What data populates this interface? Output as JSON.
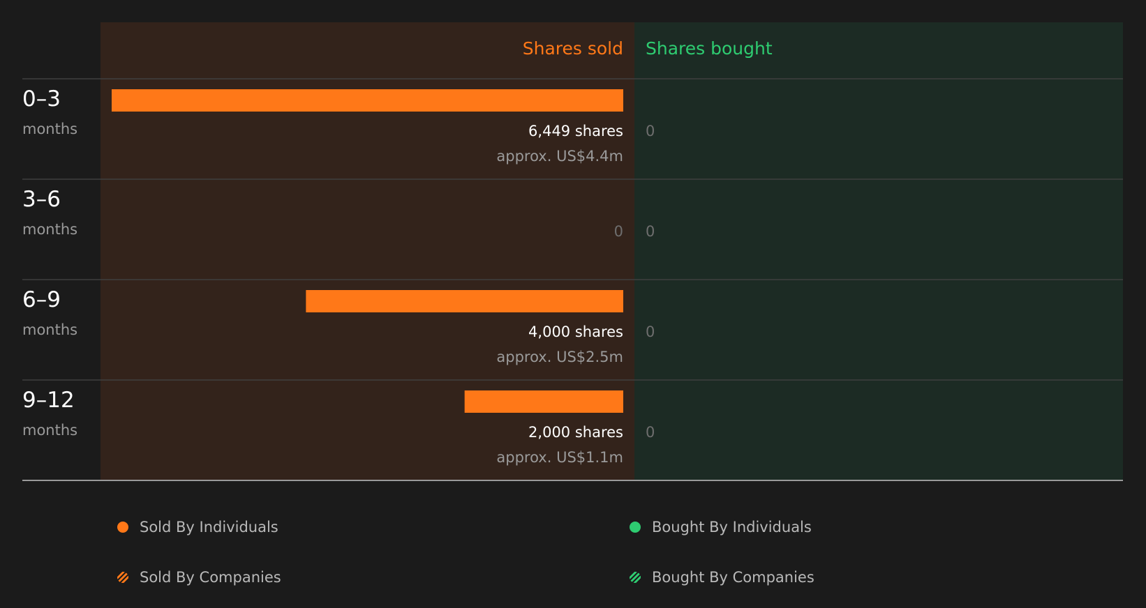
{
  "chart_data": {
    "type": "bar",
    "header": {
      "sold": "Shares sold",
      "bought": "Shares bought"
    },
    "categories": [
      {
        "range": "0–3",
        "unit": "months"
      },
      {
        "range": "3–6",
        "unit": "months"
      },
      {
        "range": "6–9",
        "unit": "months"
      },
      {
        "range": "9–12",
        "unit": "months"
      }
    ],
    "series": [
      {
        "name": "Shares sold",
        "values": [
          6449,
          0,
          4000,
          2000
        ],
        "labels": [
          "6,449 shares",
          "0",
          "4,000 shares",
          "2,000 shares"
        ],
        "value_labels": [
          "approx. US$4.4m",
          "",
          "approx. US$2.5m",
          "approx. US$1.1m"
        ]
      },
      {
        "name": "Shares bought",
        "values": [
          0,
          0,
          0,
          0
        ],
        "labels": [
          "0",
          "0",
          "0",
          "0"
        ]
      }
    ],
    "xlim": [
      0,
      6449
    ]
  },
  "legend": [
    {
      "label": "Sold By Individuals",
      "style": "dot",
      "color": "#ff7818"
    },
    {
      "label": "Bought By Individuals",
      "style": "dot",
      "color": "#2ecc71"
    },
    {
      "label": "Sold By Companies",
      "style": "hatch",
      "color": "#ff7818"
    },
    {
      "label": "Bought By Companies",
      "style": "hatch",
      "color": "#2ecc71"
    }
  ],
  "colors": {
    "background": "#1b1b1b",
    "sold_panel": "#33231b",
    "bought_panel": "#1c2b24",
    "sold_accent": "#ff7818",
    "bought_accent": "#2ecc71",
    "text_primary": "#ffffff",
    "text_secondary": "#9a9a9a",
    "zero_text": "#6e6e6e",
    "divider": "#3f3f3f",
    "baseline": "#9a9a9a"
  }
}
